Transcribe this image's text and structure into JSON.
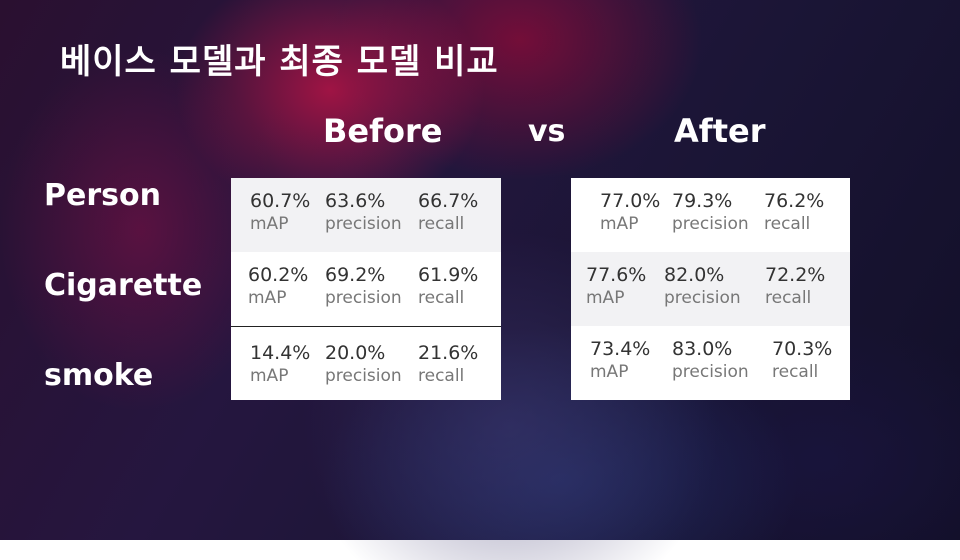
{
  "title": "베이스 모델과 최종 모델 비교",
  "headings": {
    "before": "Before",
    "vs": "vs",
    "after": "After"
  },
  "row_labels": [
    "Person",
    "Cigarette",
    "smoke"
  ],
  "metric_labels": {
    "map": "mAP",
    "precision": "precision",
    "recall": "recall"
  },
  "before": [
    {
      "map": "60.7%",
      "precision": "63.6%",
      "recall": "66.7%"
    },
    {
      "map": "60.2%",
      "precision": "69.2%",
      "recall": "61.9%"
    },
    {
      "map": "14.4%",
      "precision": "20.0%",
      "recall": "21.6%"
    }
  ],
  "after": [
    {
      "map": "77.0%",
      "precision": "79.3%",
      "recall": "76.2%"
    },
    {
      "map": "77.6%",
      "precision": "82.0%",
      "recall": "72.2%"
    },
    {
      "map": "73.4%",
      "precision": "83.0%",
      "recall": "70.3%"
    }
  ]
}
